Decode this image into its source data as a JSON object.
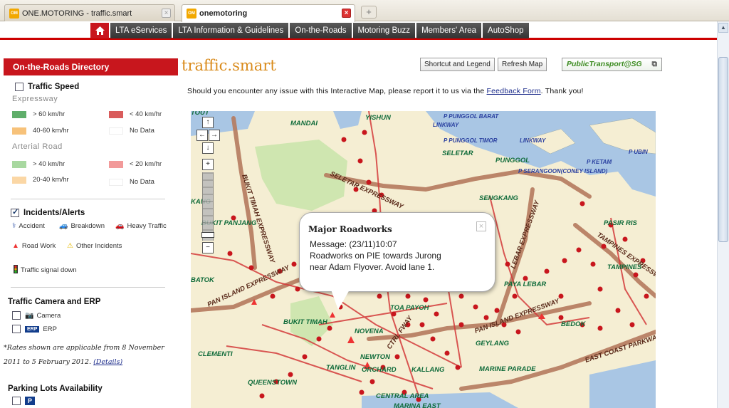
{
  "browser": {
    "tabs": [
      {
        "title": "ONE.MOTORING - traffic.smart"
      },
      {
        "title": "onemotoring"
      }
    ],
    "new_tab_icon": "+"
  },
  "nav": {
    "home_icon": "home-icon",
    "items": [
      "LTA eServices",
      "LTA Information & Guidelines",
      "On-the-Roads",
      "Motoring Buzz",
      "Members' Area",
      "AutoShop"
    ]
  },
  "sidebar": {
    "heading": "On-the-Roads Directory",
    "traffic_speed": {
      "label": "Traffic Speed",
      "expressway": "Expressway",
      "arterial": "Arterial Road",
      "exp_legend": [
        {
          "label": "> 60 km/hr",
          "color": "#5fae6a"
        },
        {
          "label": "< 40 km/hr",
          "color": "#d95c5c"
        },
        {
          "label": "40-60 km/hr",
          "color": "#f7c27a"
        },
        {
          "label": "No Data",
          "color": "#ffffff"
        }
      ],
      "art_legend": [
        {
          "label": "> 40 km/hr",
          "color": "#a8d8a0"
        },
        {
          "label": "< 20 km/hr",
          "color": "#f29a9a"
        },
        {
          "label": "20-40 km/hr",
          "color": "#fbd7a5"
        },
        {
          "label": "No Data",
          "color": "#ffffff"
        }
      ]
    },
    "incidents": {
      "label": "Incidents/Alerts",
      "items": [
        "Accident",
        "Breakdown",
        "Heavy Traffic",
        "Road Work",
        "Other Incidents",
        "Traffic signal down"
      ]
    },
    "camera": {
      "label": "Traffic Camera and ERP",
      "camera": "Camera",
      "erp": "ERP",
      "erp_badge": "ERP",
      "note": "*Rates shown are applicable from 8 November 2011 to 5 February 2012.",
      "details": "(Details)"
    },
    "parking": {
      "label": "Parking Lots Availability",
      "badge": "P"
    }
  },
  "main": {
    "title": "traffic.smart",
    "shortcut_btn": "Shortcut and Legend",
    "refresh_btn": "Refresh Map",
    "pt_btn": "PublicTransport@SG",
    "notice_pre": "Should you encounter any issue with this Interactive Map, please report it to us via the ",
    "notice_link": "Feedback Form",
    "notice_post": ". Thank you!"
  },
  "popup": {
    "title": "Major Roadworks",
    "line1": "Message: (23/11)10:07",
    "line2": "Roadworks on PIE towards Jurong",
    "line3": "near Adam Flyover. Avoid lane 1.",
    "close": "×"
  },
  "map_labels": [
    "YISHUN",
    "P PUNGGOL BARAT",
    "LINKWAY",
    "MANDAI",
    "P PUNGGOL TIMOR",
    "LINKWAY",
    "SELETAR",
    "PUNGGOL",
    "P UBIN",
    "P KETAM",
    "P SERANGOON(CONEY ISLAND)",
    "SELETAR EXPRESSWAY",
    "SENGKANG",
    "BUKIT TIMAH EXPRESSWAY",
    "KANG",
    "BUKIT PANJANG",
    "PASIR RIS",
    "TAMPINES EXPRESSWAY",
    "TAMPINES",
    "PAYA LEBAR",
    "BATOK",
    "PAN ISLAND EXPRESSWAY",
    "TOA PAYOH",
    "BUKIT TIMAH",
    "NOVENA",
    "PAN ISLAND EXPRESSWAY",
    "BEDOK",
    "GEYLANG",
    "CLEMENTI",
    "NEWTON",
    "KALLANG",
    "TANGLIN",
    "ORCHARD",
    "MARINE PARADE",
    "EAST COAST PARKWAY",
    "QUEENSTOWN",
    "CENTRAL AREA",
    "MARINA EAST",
    "TOUT",
    "LEBAR EXPRESSWAY",
    "CTRL FWAY"
  ],
  "zoom": {
    "up": "↑",
    "down": "↓",
    "left": "←",
    "right": "→",
    "plus": "+",
    "minus": "−"
  }
}
